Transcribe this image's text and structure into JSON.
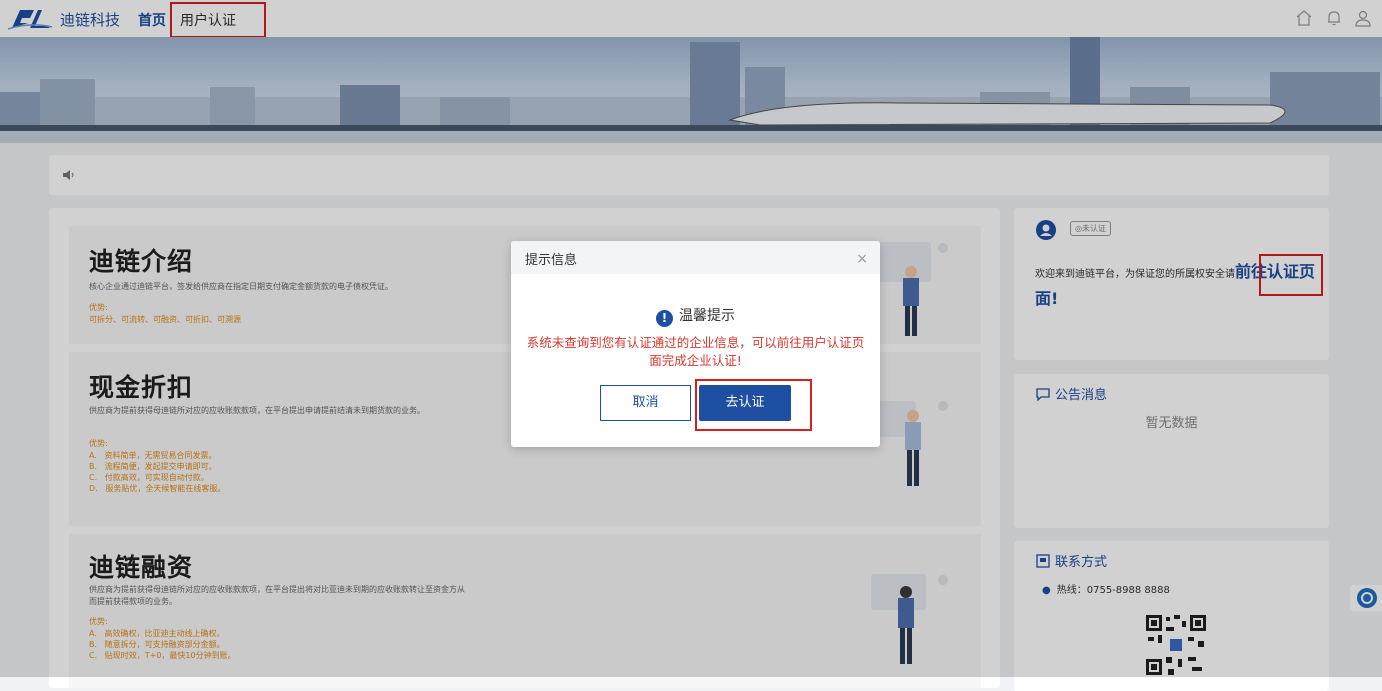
{
  "header": {
    "brand": "迪链科技",
    "nav_home": "首页",
    "nav_auth": "用户认证",
    "icons": [
      "home-icon",
      "bell-icon",
      "user-icon"
    ]
  },
  "cards": [
    {
      "title": "迪链介绍",
      "desc": "核心企业通过迪链平台，签发给供应商在指定日期支付确定金额货款的电子债权凭证。",
      "adv_label": "优势:",
      "adv_lines": [
        "可拆分、可流转、可融资、可折扣、可溯源"
      ]
    },
    {
      "title": "现金折扣",
      "desc": "供应商为提前获得母迪链所对应的应收账款款项，在平台提出申请提前结清未到期货款的业务。",
      "adv_label": "优势:",
      "adv_lines": [
        "A.   资料简单，无需贸易合同发票。",
        "B.   流程简便，发起提交申请即可。",
        "C.   付款高效，可实现自动付款。",
        "D.   服务贴优，全天候智能在线客服。"
      ]
    },
    {
      "title": "迪链融资",
      "desc": "供应商为提前获得母迪链所对应的应收账款款项，在平台提出将对比亚迪未到期的应收账款转让至资金方从而提前获得款项的业务。",
      "adv_label": "优势:",
      "adv_lines": [
        "A.   高效确权，比亚迪主动线上确权。",
        "B.   随意拆分，可支持融资部分金额。",
        "C.   贴现时效，T+0，最快10分钟到账。"
      ]
    }
  ],
  "sidebar": {
    "badge": "◎未认证",
    "welcome": "欢迎来到迪链平台，为保证您的所属权安全请",
    "go_auth": "前往认证页面!",
    "notice_title": "公告消息",
    "no_data": "暂无数据",
    "contact_title": "联系方式",
    "hotline": "热线：0755-8988 8888"
  },
  "dialog": {
    "title": "提示信息",
    "close": "×",
    "heading": "温馨提示",
    "message": "系统未查询到您有认证通过的企业信息，可以前往用户认证页面完成企业认证!",
    "cancel": "取消",
    "confirm": "去认证"
  },
  "colors": {
    "brand_blue": "#1e4fa3",
    "warning_red": "#d9362b",
    "advantage_orange": "#e08a1a",
    "highlight_box": "#d52020"
  }
}
